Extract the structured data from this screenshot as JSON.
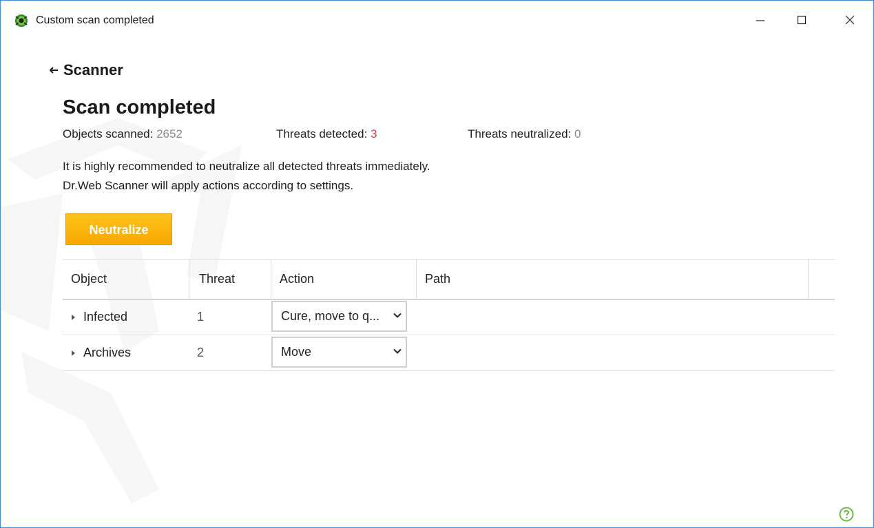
{
  "window": {
    "title": "Custom scan completed"
  },
  "nav": {
    "back_label": "Scanner"
  },
  "page": {
    "title": "Scan completed"
  },
  "stats": {
    "objects_label": "Objects scanned:",
    "objects_value": "2652",
    "detected_label": "Threats detected:",
    "detected_value": "3",
    "neutralized_label": "Threats neutralized:",
    "neutralized_value": "0"
  },
  "message": {
    "line1": "It is highly recommended to neutralize all detected threats immediately.",
    "line2": "Dr.Web Scanner will apply actions according to settings."
  },
  "actions": {
    "neutralize_label": "Neutralize"
  },
  "table": {
    "headers": {
      "object": "Object",
      "threat": "Threat",
      "action": "Action",
      "path": "Path"
    },
    "rows": [
      {
        "object": "Infected",
        "threat": "1",
        "action": "Cure, move to q...",
        "path": ""
      },
      {
        "object": "Archives",
        "threat": "2",
        "action": "Move",
        "path": ""
      }
    ]
  },
  "colors": {
    "accent": "#f7a800",
    "danger": "#e23a3a",
    "muted": "#8a8a8a",
    "help": "#5cb82d",
    "border": "#3c8fd8"
  },
  "icons": {
    "app": "drweb-spider-icon",
    "back": "arrow-left-icon",
    "help": "help-icon",
    "expand": "triangle-right-icon",
    "dropdown": "chevron-down-icon"
  }
}
